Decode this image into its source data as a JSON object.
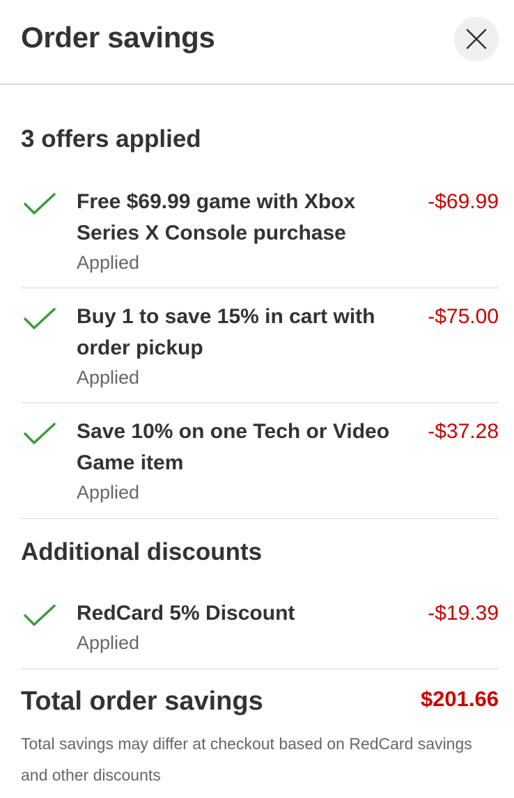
{
  "header": {
    "title": "Order savings",
    "close_icon": "close-icon"
  },
  "offers_section": {
    "heading": "3 offers applied",
    "items": [
      {
        "title": "Free $69.99 game with Xbox Series X Console purchase",
        "status": "Applied",
        "amount": "-$69.99",
        "icon": "checkmark-icon"
      },
      {
        "title": "Buy 1 to save 15% in cart with order pickup",
        "status": "Applied",
        "amount": "-$75.00",
        "icon": "checkmark-icon"
      },
      {
        "title": "Save 10% on one Tech or Video Game item",
        "status": "Applied",
        "amount": "-$37.28",
        "icon": "checkmark-icon"
      }
    ]
  },
  "additional_section": {
    "heading": "Additional discounts",
    "items": [
      {
        "title": "RedCard 5% Discount",
        "status": "Applied",
        "amount": "-$19.39",
        "icon": "checkmark-icon"
      }
    ]
  },
  "total": {
    "label": "Total order savings",
    "amount": "$201.66",
    "disclaimer": "Total savings may differ at checkout based on RedCard savings and other discounts"
  },
  "colors": {
    "check_green": "#3c9a3c",
    "amount_red": "#cc0000",
    "text_dark": "#333333",
    "text_muted": "#666666"
  }
}
